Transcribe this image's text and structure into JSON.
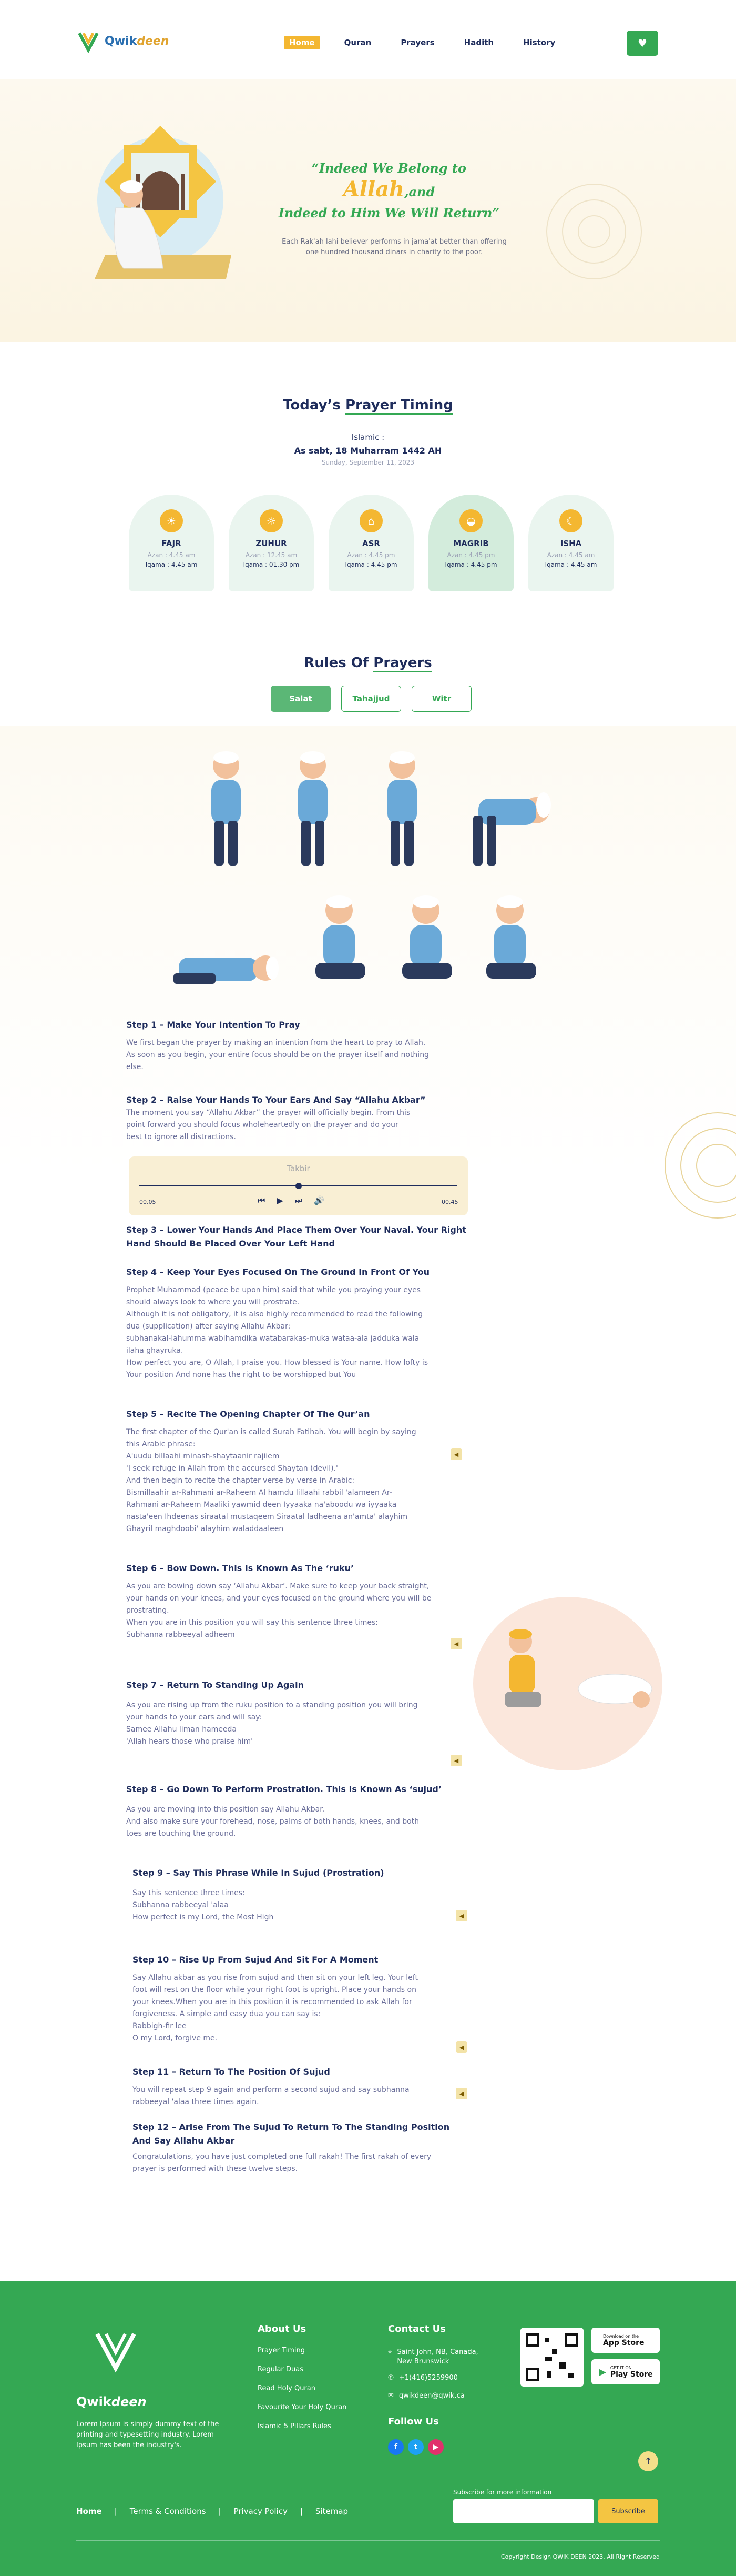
{
  "brand": {
    "name": "Qwik",
    "name_accent": "deen"
  },
  "nav": {
    "items": [
      "Home",
      "Quran",
      "Prayers",
      "Hadith",
      "History"
    ],
    "active": "Home"
  },
  "hero": {
    "title_1": "“Indeed We Belong to",
    "title_allah": "Allah",
    "title_2": ",and",
    "title_3": "Indeed to Him We Will Return”",
    "subtitle": "Each Rak'ah lahi believer performs in jama'at better than offering one hundred thousand dinars in charity to the poor."
  },
  "timing": {
    "title_a": "Today’s ",
    "title_b": "Prayer Timing",
    "islamic_label": "Islamic :",
    "hijri": "As sabt, 18 Muharram 1442 AH",
    "gregorian": "Sunday, September 11, 2023",
    "prayers": [
      {
        "name": "FAJR",
        "azan": "Azan : 4.45 am",
        "iqama": "Iqama : 4.45 am"
      },
      {
        "name": "ZUHUR",
        "azan": "Azan : 12.45 am",
        "iqama": "Iqama : 01.30 pm"
      },
      {
        "name": "ASR",
        "azan": "Azan : 4.45 pm",
        "iqama": "Iqama : 4.45 pm"
      },
      {
        "name": "MAGRIB",
        "azan": "Azan : 4.45 pm",
        "iqama": "Iqama : 4.45 pm"
      },
      {
        "name": "ISHA",
        "azan": "Azan : 4.45 am",
        "iqama": "Iqama : 4.45 am"
      }
    ]
  },
  "rules": {
    "title_a": "Rules Of ",
    "title_b": "Prayers",
    "tabs": [
      "Salat",
      "Tahajjud",
      "Witr"
    ],
    "active_tab": "Salat"
  },
  "audio": {
    "label": "Takbir",
    "elapsed": "00.05",
    "total": "00.45",
    "progress": 0.5
  },
  "steps": [
    {
      "h": "Step 1 – Make Your Intention To Pray",
      "p": [
        "We first began the prayer by making an intention from the heart to pray to Allah.",
        "As soon as you begin, your entire focus should be on the prayer itself and nothing",
        "else."
      ]
    },
    {
      "h": "Step 2 – Raise Your Hands To Your Ears And Say “Allahu Akbar”",
      "p": [
        "The moment you say “Allahu Akbar” the prayer will officially begin. From this",
        "point forward you should focus wholeheartedly on the prayer and do your",
        "best to ignore all distractions."
      ]
    },
    {
      "h": "Step 3 – Lower Your Hands And Place Them Over Your Naval. Your Right Hand Should Be Placed Over Your Left Hand",
      "p": []
    },
    {
      "h": "Step 4 – Keep Your Eyes Focused On The Ground In Front Of You",
      "p": [
        "Prophet Muhammad (peace be upon him) said that while you praying your eyes",
        "should always look to where you will prostrate.",
        "Although it is not obligatory, it is also highly recommended to read the following",
        "dua (supplication) after saying Allahu Akbar:",
        "subhanakal-lahumma wabihamdika watabarakas-muka wataa-ala jadduka wala",
        "ilaha ghayruka.",
        "How perfect you are, O Allah, I praise you. How blessed is Your name. How lofty is",
        "Your position And none has the right to be worshipped but You"
      ]
    },
    {
      "h": "Step 5 – Recite The Opening Chapter Of The Qur’an",
      "p": [
        "The first chapter of the Qur'an is called Surah Fatihah. You will begin by saying",
        "this Arabic phrase:",
        "A'uudu billaahi minash-shaytaanir rajiiem",
        "'I seek refuge in Allah from the accursed Shaytan (devil).'",
        "And then begin to recite the chapter verse by verse in Arabic:",
        "Bismillaahir ar-Rahmani ar-Raheem Al hamdu lillaahi rabbil 'alameen Ar-",
        "Rahmani ar-Raheem Maaliki yawmid deen Iyyaaka na'aboodu wa iyyaaka",
        "nasta'een Ihdeenas siraatal mustaqeem Siraatal ladheena an'amta' alayhim",
        "Ghayril maghdoobi' alayhim waladdaaleen"
      ]
    },
    {
      "h": "Step 6 – Bow Down. This Is Known As The ‘ruku’",
      "p": [
        "As you are bowing down say ‘Allahu Akbar’. Make sure to keep your back straight,",
        "your hands on your knees, and your eyes focused on the ground where you will be",
        "prostrating.",
        "When you are in this position you will say this sentence three times:",
        "Subhanna rabbeeyal adheem"
      ]
    },
    {
      "h": "Step 7 – Return To Standing Up Again",
      "p": [
        "As you are rising up from the ruku position to a standing position you will bring",
        "your hands to your ears and will say:",
        "Samee Allahu liman hameeda",
        "'Allah hears those who praise him'"
      ]
    },
    {
      "h": "Step 8 – Go Down To Perform Prostration. This Is Known As ‘sujud’",
      "p": [
        "As you are moving into this position say Allahu Akbar.",
        "And also make sure your forehead, nose, palms of both hands, knees, and both",
        "toes are touching the ground."
      ]
    },
    {
      "h": "Step 9 – Say This Phrase While In Sujud (Prostration)",
      "p": [
        "Say this sentence three times:",
        "Subhanna rabbeeyal 'alaa",
        "How perfect is my Lord, the Most High"
      ]
    },
    {
      "h": "Step 10 – Rise Up From Sujud And Sit For A Moment",
      "p": [
        "Say Allahu akbar as you rise from sujud and then sit on your left leg. Your left",
        "foot will rest on the floor while your right foot is upright. Place your hands on",
        "your knees.When you are in this position it is recommended to ask Allah for",
        "forgiveness. A simple and easy dua you can say is:",
        "Rabbigh-fir lee",
        "O my Lord, forgive me."
      ]
    },
    {
      "h": "Step 11 – Return To The Position Of Sujud",
      "p": [
        "You will repeat step 9 again and perform a second sujud and say subhanna",
        "rabbeeyal 'alaa three times again."
      ]
    },
    {
      "h": "Step 12 – Arise From The Sujud To Return To The Standing Position And Say Allahu Akbar",
      "p": [
        "Congratulations, you have just completed one full rakah! The first rakah of every",
        "prayer is performed with these twelve steps."
      ]
    }
  ],
  "footer": {
    "about": "Lorem Ipsum is simply dummy text of the printing and typesetting industry. Lorem Ipsum has been the industry's.",
    "about_title": "About Us",
    "about_links": [
      "Prayer Timing",
      "Regular Duas",
      "Read Holy Quran",
      "Favourite Your Holy Quran",
      "Islamic 5 Pillars Rules"
    ],
    "contact_title": "Contact Us",
    "address_1": "Saint John, NB, Canada,",
    "address_2": "New Brunswick",
    "phone": "+1(416)5259900",
    "email": "qwikdeen@qwik.ca",
    "follow": "Follow Us",
    "appstore_small": "Download on the",
    "appstore": "App Store",
    "playstore_small": "GET IT ON",
    "playstore": "Play Store",
    "bottom_links": [
      "Home",
      "Terms & Conditions",
      "Privacy Policy",
      "Sitemap"
    ],
    "subscribe_label": "Subscribe for more information",
    "subscribe_btn": "Subscribe",
    "copyright": "Copyright Design QWIK DEEN 2023. All Right Reserved"
  },
  "colors": {
    "green": "#34a853",
    "gold": "#f4b731",
    "navy": "#1f2d5c"
  }
}
